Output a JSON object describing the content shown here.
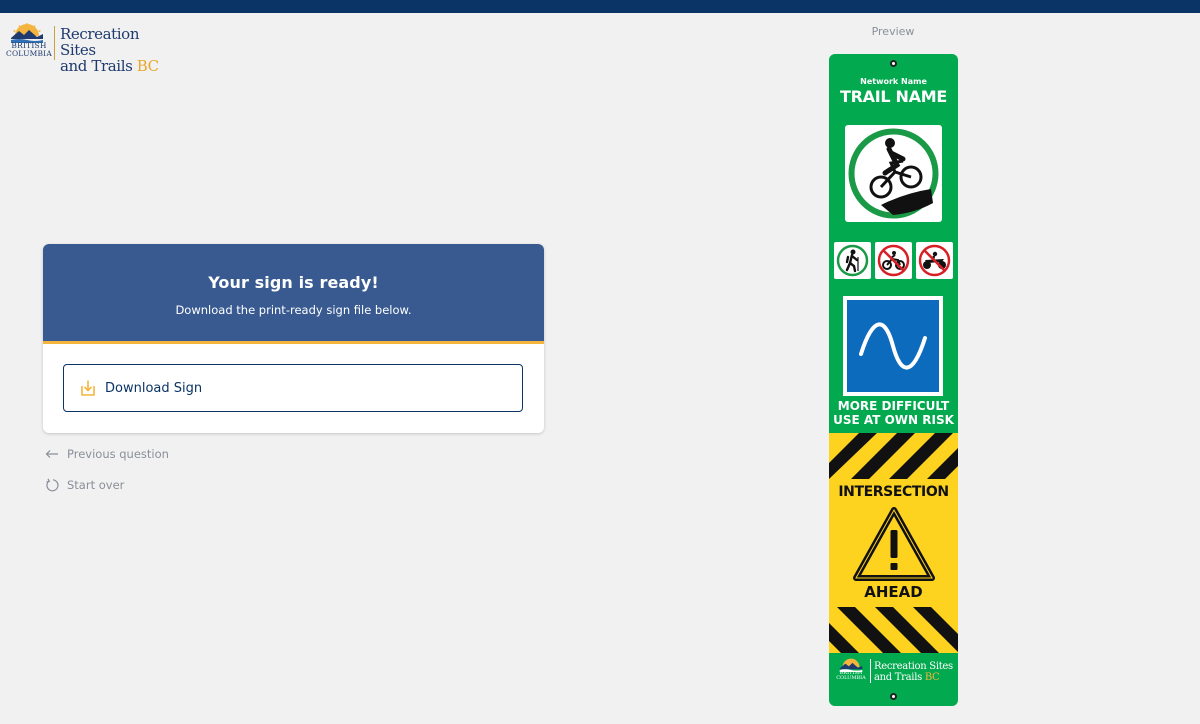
{
  "brand": {
    "province_line1": "BRITISH",
    "province_line2": "COLUMBIA",
    "title_line1": "Recreation Sites",
    "title_line2_prefix": "and Trails",
    "title_line2_suffix": "BC"
  },
  "card": {
    "heading": "Your sign is ready!",
    "subheading": "Download the print-ready sign file below.",
    "download_label": "Download Sign"
  },
  "nav": {
    "previous_label": "Previous question",
    "start_over_label": "Start over"
  },
  "preview": {
    "label": "Preview",
    "sign": {
      "network_name": "Network Name",
      "trail_name": "TRAIL NAME",
      "primary_activity_icon": "mountain-bike-icon",
      "allowed_icons": [
        "hiker-icon"
      ],
      "prohibited_icons": [
        "dirt-bike-icon",
        "atv-icon"
      ],
      "difficulty_line1": "MORE DIFFICULT",
      "difficulty_line2": "USE AT OWN RISK",
      "warning_title": "INTERSECTION",
      "warning_subtitle": "AHEAD",
      "footer_province_line1": "BRITISH",
      "footer_province_line2": "COLUMBIA",
      "footer_title_line1": "Recreation Sites",
      "footer_title_line2_prefix": "and Trails",
      "footer_title_line2_suffix": "BC"
    }
  },
  "colors": {
    "top_bar": "#0b3466",
    "card_header": "#385a91",
    "accent": "#f3b53e",
    "sign_green": "#03a94f",
    "difficulty_blue": "#0d6bbd",
    "warning_yellow": "#fdd320"
  }
}
